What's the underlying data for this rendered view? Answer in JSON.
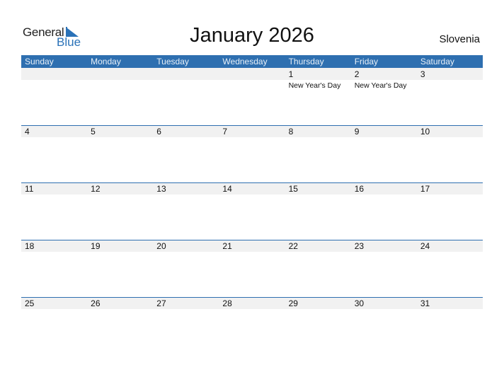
{
  "logo": {
    "general": "General",
    "blue": "Blue"
  },
  "title": "January 2026",
  "country": "Slovenia",
  "colors": {
    "accent": "#2e6fb0",
    "strip": "#f1f1f1"
  },
  "weekdays": [
    "Sunday",
    "Monday",
    "Tuesday",
    "Wednesday",
    "Thursday",
    "Friday",
    "Saturday"
  ],
  "weeks": [
    [
      {
        "d": ""
      },
      {
        "d": ""
      },
      {
        "d": ""
      },
      {
        "d": ""
      },
      {
        "d": "1",
        "h": "New Year's Day"
      },
      {
        "d": "2",
        "h": "New Year's Day"
      },
      {
        "d": "3"
      }
    ],
    [
      {
        "d": "4"
      },
      {
        "d": "5"
      },
      {
        "d": "6"
      },
      {
        "d": "7"
      },
      {
        "d": "8"
      },
      {
        "d": "9"
      },
      {
        "d": "10"
      }
    ],
    [
      {
        "d": "11"
      },
      {
        "d": "12"
      },
      {
        "d": "13"
      },
      {
        "d": "14"
      },
      {
        "d": "15"
      },
      {
        "d": "16"
      },
      {
        "d": "17"
      }
    ],
    [
      {
        "d": "18"
      },
      {
        "d": "19"
      },
      {
        "d": "20"
      },
      {
        "d": "21"
      },
      {
        "d": "22"
      },
      {
        "d": "23"
      },
      {
        "d": "24"
      }
    ],
    [
      {
        "d": "25"
      },
      {
        "d": "26"
      },
      {
        "d": "27"
      },
      {
        "d": "28"
      },
      {
        "d": "29"
      },
      {
        "d": "30"
      },
      {
        "d": "31"
      }
    ]
  ]
}
